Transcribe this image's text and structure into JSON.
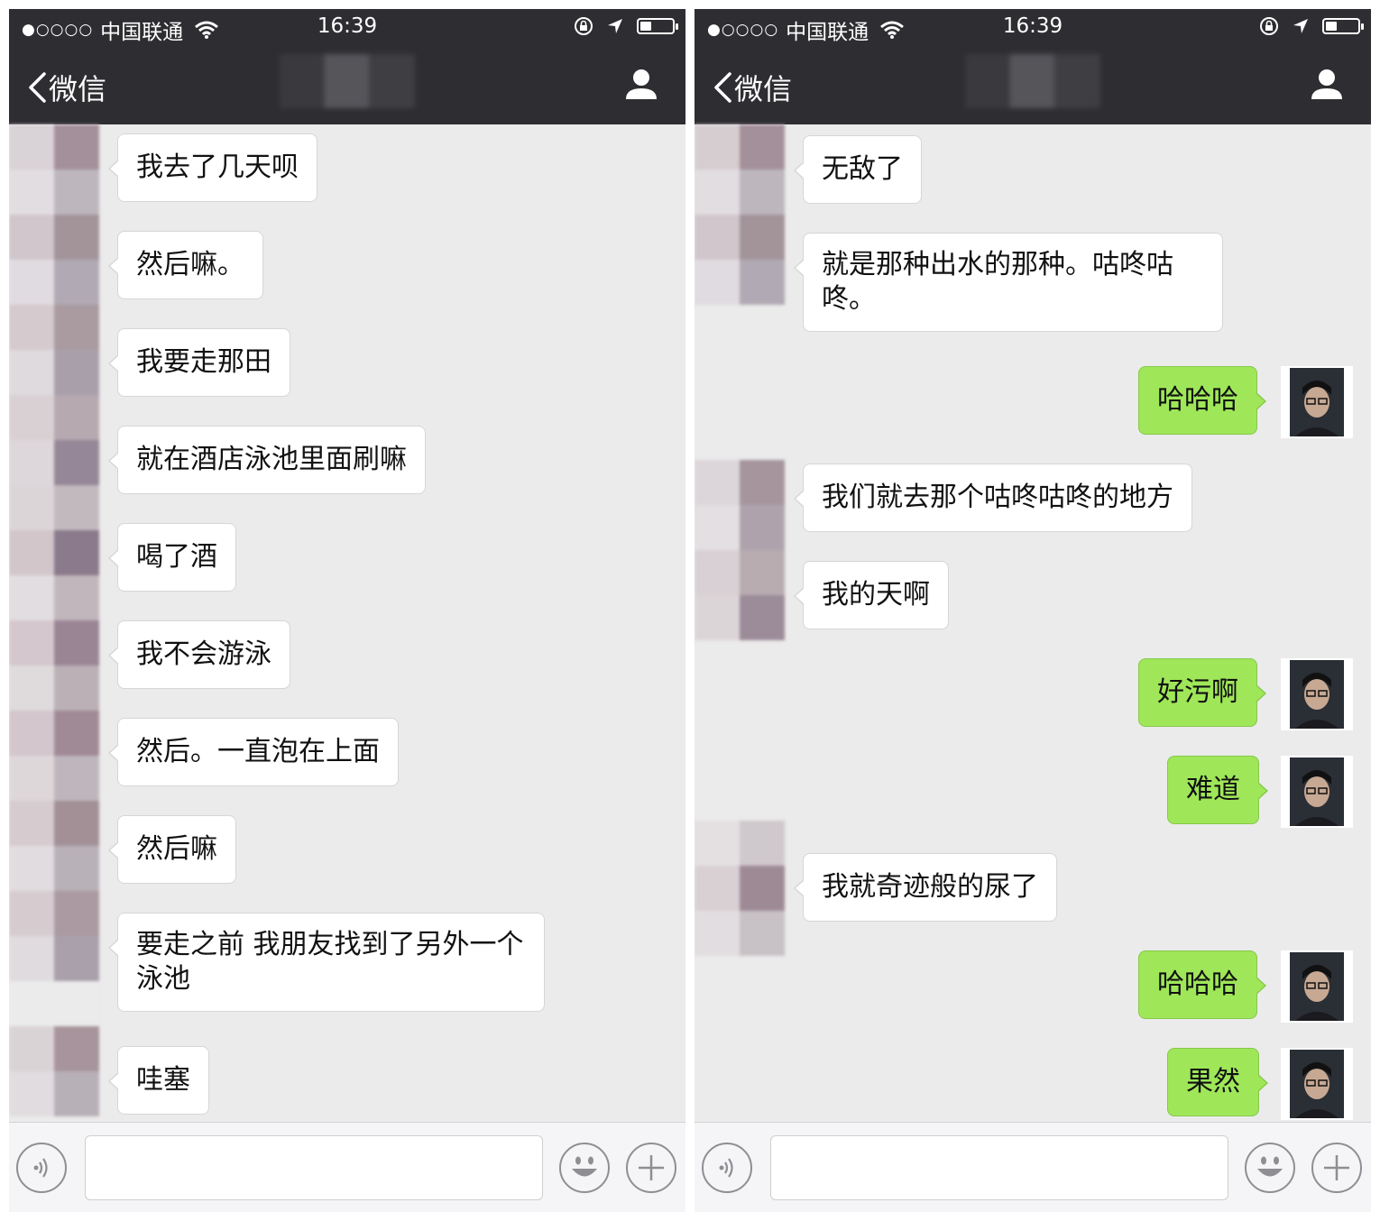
{
  "colors": {
    "header_bg": "#2e2e32",
    "chat_bg": "#ebebeb",
    "incoming_bubble": "#ffffff",
    "outgoing_bubble": "#9fe759"
  },
  "screens": [
    {
      "status": {
        "signal": "●○○○○",
        "carrier": "中国联通",
        "time": "16:39"
      },
      "nav": {
        "back_label": "微信"
      },
      "messages": [
        {
          "dir": "in",
          "text": "我去了几天呗"
        },
        {
          "dir": "in",
          "text": "然后嘛。"
        },
        {
          "dir": "in",
          "text": "我要走那田"
        },
        {
          "dir": "in",
          "text": "就在酒店泳池里面刷嘛"
        },
        {
          "dir": "in",
          "text": "喝了酒"
        },
        {
          "dir": "in",
          "text": "我不会游泳"
        },
        {
          "dir": "in",
          "text": "然后。一直泡在上面"
        },
        {
          "dir": "in",
          "text": "然后嘛"
        },
        {
          "dir": "in",
          "text": "要走之前 我朋友找到了另外一个泳池"
        },
        {
          "dir": "in",
          "text": "哇塞"
        }
      ],
      "input": {
        "value": ""
      }
    },
    {
      "status": {
        "signal": "●○○○○",
        "carrier": "中国联通",
        "time": "16:39"
      },
      "nav": {
        "back_label": "微信"
      },
      "messages": [
        {
          "dir": "in",
          "text": "无敌了"
        },
        {
          "dir": "in",
          "text": "就是那种出水的那种。咕咚咕咚。"
        },
        {
          "dir": "out",
          "text": "哈哈哈"
        },
        {
          "dir": "in",
          "text": "我们就去那个咕咚咕咚的地方"
        },
        {
          "dir": "in",
          "text": "我的天啊"
        },
        {
          "dir": "out",
          "text": "好污啊"
        },
        {
          "dir": "out",
          "text": "难道"
        },
        {
          "dir": "in",
          "text": "我就奇迹般的尿了"
        },
        {
          "dir": "out",
          "text": "哈哈哈"
        },
        {
          "dir": "out",
          "text": "果然"
        }
      ],
      "input": {
        "value": ""
      }
    }
  ]
}
